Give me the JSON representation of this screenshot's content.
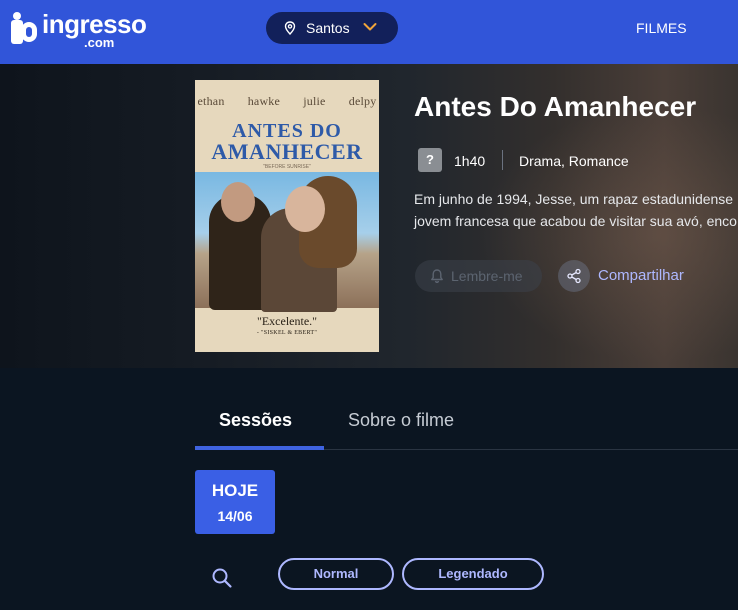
{
  "header": {
    "logo_word": "ingresso",
    "logo_suffix": ".com",
    "city": "Santos",
    "nav_filmes": "FILMES"
  },
  "movie": {
    "poster": {
      "actor_1": "ethan hawke",
      "actor_2": "julie delpy",
      "title_line_1": "ANTES DO",
      "title_line_2": "AMANHECER",
      "subtitle": "\"BEFORE SUNRISE\"",
      "quote": "\"Excelente.\"",
      "attribution": "- \"SISKEL & EBERT\""
    },
    "title": "Antes Do Amanhecer",
    "rating": "?",
    "duration": "1h40",
    "genres": "Drama, Romance",
    "synopsis_line_1": "Em junho de 1994, Jesse, um rapaz estadunidense",
    "synopsis_line_2": "jovem francesa que acabou de visitar sua avó, enco",
    "remind_label": "Lembre-me",
    "share_label": "Compartilhar"
  },
  "tabs": [
    {
      "label": "Sessões",
      "active": true
    },
    {
      "label": "Sobre o filme",
      "active": false
    }
  ],
  "date": {
    "day_label": "HOJE",
    "date": "14/06"
  },
  "filters": [
    {
      "label": "Normal"
    },
    {
      "label": "Legendado"
    }
  ],
  "colors": {
    "header": "#3155d9",
    "accent": "#3a5fe5",
    "link": "#aeb8ff",
    "background": "#0b1521"
  }
}
